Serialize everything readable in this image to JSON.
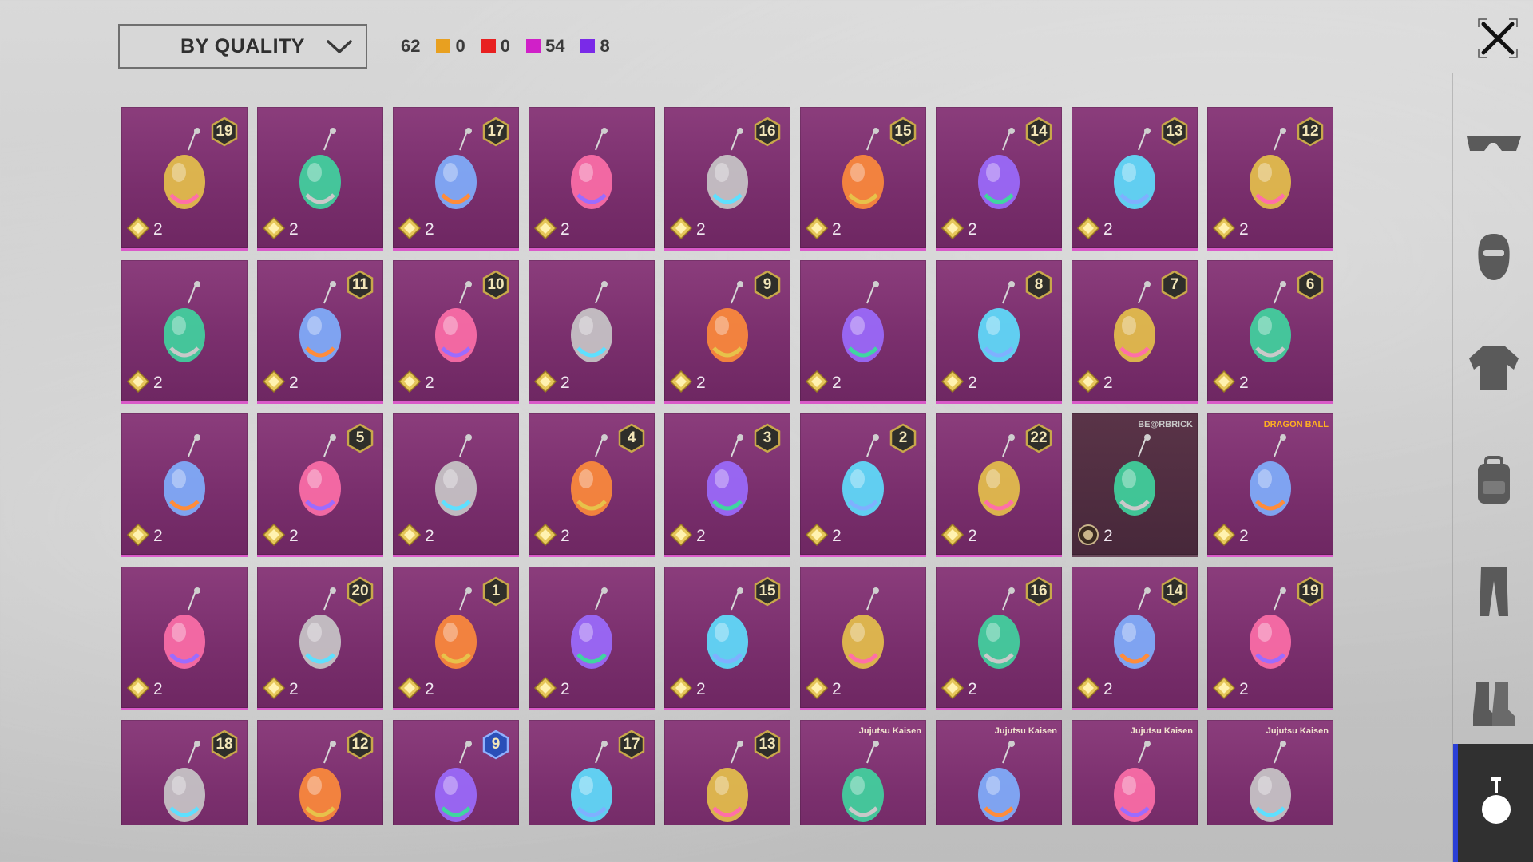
{
  "sort": {
    "label": "BY QUALITY"
  },
  "counts": {
    "total": "62",
    "tiers": [
      {
        "color": "#e8a020",
        "value": "0"
      },
      {
        "color": "#e82020",
        "value": "0"
      },
      {
        "color": "#d020c8",
        "value": "54"
      },
      {
        "color": "#7a2ae8",
        "value": "8"
      }
    ]
  },
  "icons": {
    "close": "close-icon",
    "chevron": "chevron-down-icon",
    "cost": "diamond-coin-icon"
  },
  "items": [
    {
      "level": "19",
      "cost": "2",
      "icon": "bow-leaf-pendant"
    },
    {
      "level": "",
      "cost": "2",
      "icon": "crescent-blade-pendant"
    },
    {
      "level": "17",
      "cost": "2",
      "icon": "emerald-pendant"
    },
    {
      "level": "",
      "cost": "2",
      "icon": "skull-mask-pendant"
    },
    {
      "level": "16",
      "cost": "2",
      "icon": "scythe-pendant"
    },
    {
      "level": "15",
      "cost": "2",
      "icon": "syringe-pendant"
    },
    {
      "level": "14",
      "cost": "2",
      "icon": "purple-cat-pendant"
    },
    {
      "level": "13",
      "cost": "2",
      "icon": "bunny-mirror-pendant"
    },
    {
      "level": "12",
      "cost": "2",
      "icon": "sunflower-pendant"
    },
    {
      "level": "",
      "cost": "2",
      "icon": "cat-figure-pendant"
    },
    {
      "level": "11",
      "cost": "2",
      "icon": "red-crystal-pendant"
    },
    {
      "level": "10",
      "cost": "2",
      "icon": "dark-cloak-pendant"
    },
    {
      "level": "",
      "cost": "2",
      "icon": "arm-pendant"
    },
    {
      "level": "9",
      "cost": "2",
      "icon": "blue-gourd-pendant"
    },
    {
      "level": "",
      "cost": "2",
      "icon": "white-bunny-pendant"
    },
    {
      "level": "8",
      "cost": "2",
      "icon": "seahorse-pendant"
    },
    {
      "level": "7",
      "cost": "2",
      "icon": "red-phone-pendant"
    },
    {
      "level": "6",
      "cost": "2",
      "icon": "purple-dagger-pendant"
    },
    {
      "level": "",
      "cost": "2",
      "icon": "flamingo-pendant"
    },
    {
      "level": "5",
      "cost": "2",
      "icon": "firecracker-pendant"
    },
    {
      "level": "",
      "cost": "2",
      "icon": "green-leaf-pendant"
    },
    {
      "level": "4",
      "cost": "2",
      "icon": "snail-pendant"
    },
    {
      "level": "3",
      "cost": "2",
      "icon": "disco-ball-pendant"
    },
    {
      "level": "2",
      "cost": "2",
      "icon": "unicorn-pendant"
    },
    {
      "level": "22",
      "cost": "2",
      "icon": "gear-eye-pendant"
    },
    {
      "level": "",
      "cost": "2",
      "icon": "bearbrick-pendant",
      "brand": "BE@RBRICK",
      "variant": "dark"
    },
    {
      "level": "",
      "cost": "2",
      "icon": "dragon-ball-pendant",
      "brand": "DRAGON BALL"
    },
    {
      "level": "",
      "cost": "2",
      "icon": "lucky-cat-pendant"
    },
    {
      "level": "20",
      "cost": "2",
      "icon": "lantern-box-pendant"
    },
    {
      "level": "1",
      "cost": "2",
      "icon": "robot-tank-pendant"
    },
    {
      "level": "",
      "cost": "2",
      "icon": "boxing-glove-pendant"
    },
    {
      "level": "15",
      "cost": "2",
      "icon": "jester-box-pendant"
    },
    {
      "level": "",
      "cost": "2",
      "icon": "black-cube-pendant"
    },
    {
      "level": "16",
      "cost": "2",
      "icon": "medusa-pendant"
    },
    {
      "level": "14",
      "cost": "2",
      "icon": "gem-ring-pendant"
    },
    {
      "level": "19",
      "cost": "2",
      "icon": "octopus-eye-pendant"
    },
    {
      "level": "18",
      "cost": "2",
      "icon": "glass-slipper-pendant"
    },
    {
      "level": "12",
      "cost": "2",
      "icon": "ufo-pendant"
    },
    {
      "level": "9",
      "cost": "",
      "icon": "armor-helmet-pendant",
      "badge_color": "blue"
    },
    {
      "level": "17",
      "cost": "",
      "icon": "golden-chalice-pendant"
    },
    {
      "level": "13",
      "cost": "",
      "icon": "scroll-jar-pendant"
    },
    {
      "level": "",
      "cost": "",
      "icon": "gojo-chibi-pendant",
      "brand": "Jujutsu Kaisen"
    },
    {
      "level": "",
      "cost": "",
      "icon": "nobara-chibi-pendant",
      "brand": "Jujutsu Kaisen"
    },
    {
      "level": "",
      "cost": "",
      "icon": "megumi-chibi-pendant",
      "brand": "Jujutsu Kaisen"
    },
    {
      "level": "",
      "cost": "",
      "icon": "yuji-chibi-pendant",
      "brand": "Jujutsu Kaisen"
    }
  ],
  "sidebar": [
    {
      "name": "sidebar-glasses",
      "icon": "glasses-icon"
    },
    {
      "name": "sidebar-mask",
      "icon": "mask-icon"
    },
    {
      "name": "sidebar-jacket",
      "icon": "jacket-icon"
    },
    {
      "name": "sidebar-backpack",
      "icon": "backpack-icon"
    },
    {
      "name": "sidebar-pants",
      "icon": "pants-icon"
    },
    {
      "name": "sidebar-boots",
      "icon": "boots-icon"
    },
    {
      "name": "sidebar-pendant",
      "icon": "pendant-icon",
      "active": true
    }
  ]
}
